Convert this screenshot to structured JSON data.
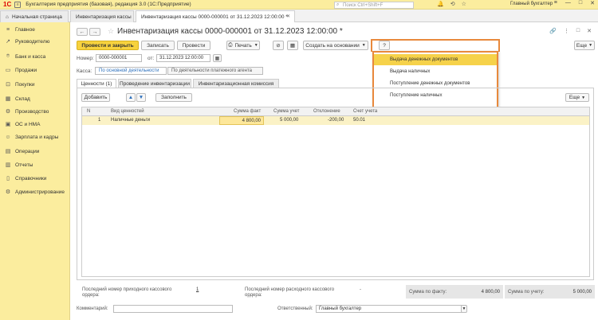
{
  "titlebar": {
    "logo": "1С",
    "app_title": "Бухгалтерия предприятия (базовая), редакция 3.0  (1С:Предприятие)",
    "search_placeholder": "Поиск Ctrl+Shift+F",
    "user": "Главный бухгалтер"
  },
  "tabs": [
    {
      "label": "Начальная страница"
    },
    {
      "label": "Инвентаризация кассы"
    },
    {
      "label": "Инвентаризация кассы 0000-000001 от 31.12.2023 12:00:00 *"
    }
  ],
  "sidebar": {
    "items": [
      {
        "label": "Главное",
        "icon": "menu-icon"
      },
      {
        "label": "Руководителю",
        "icon": "chart-icon"
      },
      {
        "label": "Банк и касса",
        "icon": "bank-icon"
      },
      {
        "label": "Продажи",
        "icon": "sales-icon"
      },
      {
        "label": "Покупки",
        "icon": "cart-icon"
      },
      {
        "label": "Склад",
        "icon": "warehouse-icon"
      },
      {
        "label": "Производство",
        "icon": "factory-icon"
      },
      {
        "label": "ОС и НМА",
        "icon": "assets-icon"
      },
      {
        "label": "Зарплата и кадры",
        "icon": "people-icon"
      },
      {
        "label": "Операции",
        "icon": "operations-icon"
      },
      {
        "label": "Отчеты",
        "icon": "reports-icon"
      },
      {
        "label": "Справочники",
        "icon": "book-icon"
      },
      {
        "label": "Администрирование",
        "icon": "gear-icon"
      }
    ]
  },
  "doc": {
    "title": "Инвентаризация кассы 0000-000001 от 31.12.2023 12:00:00 *"
  },
  "toolbar": {
    "post_close": "Провести и закрыть",
    "save": "Записать",
    "post": "Провести",
    "print": "Печать",
    "create_based": "Создать на основании",
    "help": "?",
    "more": "Еще"
  },
  "create_menu": {
    "items": [
      "Выдача денежных документов",
      "Выдача наличных",
      "Поступление денежных документов",
      "Поступление наличных"
    ]
  },
  "form": {
    "number_label": "Номер:",
    "number_value": "0000-000001",
    "date_label": "от:",
    "date_value": "31.12.2023 12:00:00",
    "cash_label": "Касса:",
    "cash_opt1": "По основной деятельности",
    "cash_opt2": "По деятельности платежного агента"
  },
  "subtabs": [
    {
      "label": "Ценности (1)"
    },
    {
      "label": "Проведение инвентаризации"
    },
    {
      "label": "Инвентаризационная комиссия"
    }
  ],
  "table_toolbar": {
    "add": "Добавить",
    "fill": "Заполнить",
    "more": "Еще"
  },
  "table": {
    "headers": [
      "N",
      "Вид ценностей",
      "Сумма факт",
      "Сумма учет",
      "Отклонение",
      "Счет учета"
    ],
    "rows": [
      {
        "n": "1",
        "kind": "Наличные деньги",
        "fact": "4 800,00",
        "account_sum": "5 000,00",
        "diff": "-200,00",
        "account": "50.01"
      }
    ]
  },
  "footer": {
    "last_in_label": "Последний номер приходного кассового ордера:",
    "last_in_value": "1",
    "last_out_label": "Последний номер расходного кассового ордера:",
    "last_out_value": "-",
    "fact_label": "Сумма по факту:",
    "fact_value": "4 800,00",
    "account_label": "Сумма по учету:",
    "account_value": "5 000,00"
  },
  "bottom": {
    "comment_label": "Комментарий:",
    "comment_value": "",
    "responsible_label": "Ответственный:",
    "responsible_value": "Главный бухгалтер"
  }
}
